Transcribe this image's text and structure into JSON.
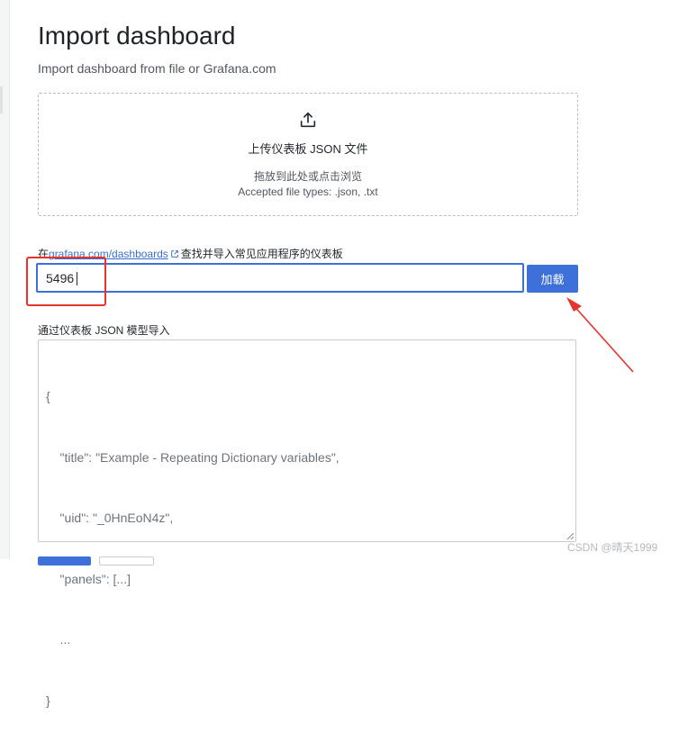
{
  "page": {
    "title": "Import dashboard",
    "subtitle": "Import dashboard from file or Grafana.com"
  },
  "upload": {
    "icon": "upload-icon",
    "title": "上传仪表板 JSON 文件",
    "hint": "拖放到此处或点击浏览",
    "types": "Accepted file types: .json, .txt"
  },
  "grafana_com": {
    "label_prefix": "在",
    "link_text": "grafana.com/dashboards",
    "link_icon": "external-link-icon",
    "label_suffix": "查找并导入常见应用程序的仪表板",
    "input_value": "5496",
    "load_button": "加载"
  },
  "json_model": {
    "label": "通过仪表板 JSON 模型导入",
    "placeholder_lines": [
      "{",
      "    \"title\": \"Example - Repeating Dictionary variables\",",
      "    \"uid\": \"_0HnEoN4z\",",
      "    \"panels\": [...]",
      "    ...",
      "}"
    ]
  },
  "watermark": "CSDN @晴天1999",
  "colors": {
    "accent": "#3d71d9",
    "annotation": "#e8332a",
    "link": "#3b6fd4"
  }
}
